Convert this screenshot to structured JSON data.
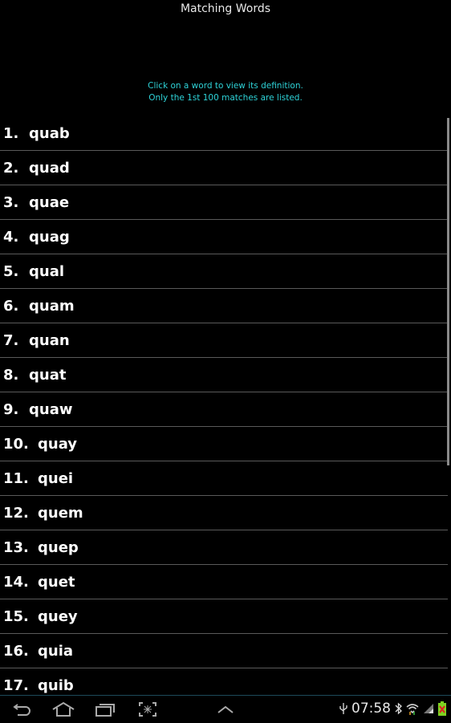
{
  "header": {
    "title": "Matching Words",
    "hint_line1": "Click on a word to view its definition.",
    "hint_line2": "Only the 1st 100 matches are listed."
  },
  "words": [
    {
      "num": "1.",
      "word": "quab"
    },
    {
      "num": "2.",
      "word": "quad"
    },
    {
      "num": "3.",
      "word": "quae"
    },
    {
      "num": "4.",
      "word": "quag"
    },
    {
      "num": "5.",
      "word": "qual"
    },
    {
      "num": "6.",
      "word": "quam"
    },
    {
      "num": "7.",
      "word": "quan"
    },
    {
      "num": "8.",
      "word": "quat"
    },
    {
      "num": "9.",
      "word": "quaw"
    },
    {
      "num": "10.",
      "word": "quay"
    },
    {
      "num": "11.",
      "word": "quei"
    },
    {
      "num": "12.",
      "word": "quem"
    },
    {
      "num": "13.",
      "word": "quep"
    },
    {
      "num": "14.",
      "word": "quet"
    },
    {
      "num": "15.",
      "word": "quey"
    },
    {
      "num": "16.",
      "word": "quia"
    },
    {
      "num": "17.",
      "word": "quib"
    }
  ],
  "navbar": {
    "icons": [
      "back-icon",
      "home-icon",
      "recent-apps-icon",
      "screenshot-icon",
      "up-arrow-icon"
    ],
    "clock": "07:58",
    "status_icons": [
      "usb-icon",
      "bluetooth-icon",
      "wifi-icon",
      "signal-icon",
      "battery-icon"
    ],
    "accent_color": "#2ed3d8"
  }
}
